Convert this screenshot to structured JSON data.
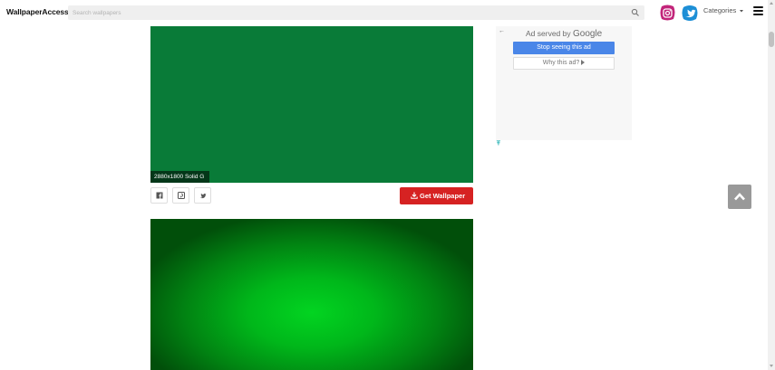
{
  "header": {
    "logo": "WallpaperAccess",
    "search_placeholder": "Search wallpapers",
    "categories_label": "Categories",
    "icons": [
      "search-icon",
      "instagram-icon",
      "twitter-icon",
      "caret-down-icon",
      "hamburger-menu-icon"
    ]
  },
  "wallpapers": [
    {
      "caption": "2880x1800 Solid G",
      "color": "#097b38"
    },
    {
      "caption": "",
      "color": "#02d421"
    }
  ],
  "actions": {
    "share_icons": [
      "facebook-icon",
      "pinterest-icon",
      "twitter-icon"
    ],
    "get_wallpaper_label": "Get Wallpaper",
    "get_wallpaper_icon": "download-icon"
  },
  "ad": {
    "back_arrow": "←",
    "served_by_prefix": "Ad served by",
    "served_by_brand": "Google",
    "stop_label": "Stop seeing this ad",
    "why_label": "Why this ad?"
  },
  "colors": {
    "accent_red": "#d62222",
    "ad_blue": "#4a86e8",
    "top_button": "#999999"
  }
}
